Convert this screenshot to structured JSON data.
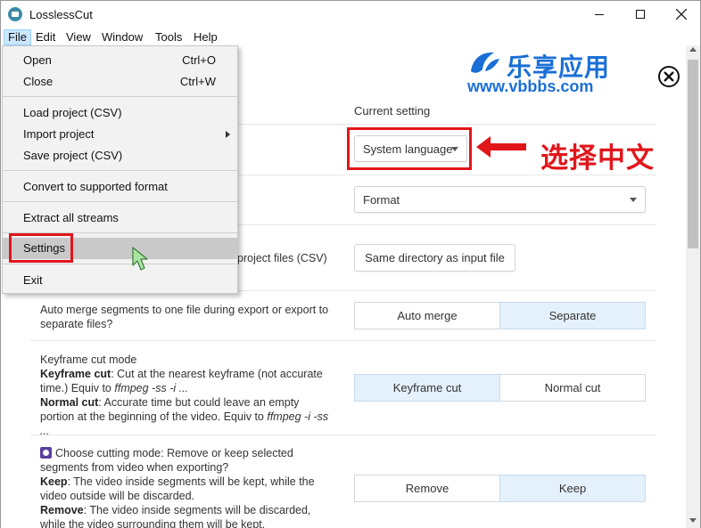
{
  "window": {
    "title": "LosslessCut"
  },
  "menubar": [
    "File",
    "Edit",
    "View",
    "Window",
    "Tools",
    "Help"
  ],
  "file_menu": {
    "open": "Open",
    "open_shortcut": "Ctrl+O",
    "close": "Close",
    "close_shortcut": "Ctrl+W",
    "load_project": "Load project (CSV)",
    "import_project": "Import project",
    "save_project": "Save project (CSV)",
    "convert": "Convert to supported format",
    "extract": "Extract all streams",
    "settings": "Settings",
    "exit": "Exit"
  },
  "watermark": {
    "cn": "乐享应用",
    "url": "www.vbbbs.com"
  },
  "annotation": "选择中文",
  "settings": {
    "current_setting_header": "Current setting",
    "language_value": "System language",
    "format_value": "Format",
    "project_files_tail": "project files (CSV)",
    "project_dir_button": "Same directory as input file",
    "auto_merge_label": "Auto merge segments to one file during export or export to separate files?",
    "auto_merge_btn": "Auto merge",
    "separate_btn": "Separate",
    "keyframe_title": "Keyframe cut mode",
    "keyframe_bold": "Keyframe cut",
    "keyframe_desc": ": Cut at the nearest keyframe (not accurate time.) Equiv to ",
    "keyframe_cmd": "ffmpeg -ss -i ...",
    "normal_bold": "Normal cut",
    "normal_desc": ": Accurate time but could leave an empty portion at the beginning of the video. Equiv to ",
    "normal_cmd": "ffmpeg -i -ss ...",
    "keyframe_btn": "Keyframe cut",
    "normal_btn": "Normal cut",
    "cutting_mode_label": "Choose cutting mode: Remove or keep selected segments from video when exporting?",
    "keep_bold": "Keep",
    "keep_desc": ": The video inside segments will be kept, while the video outside will be discarded.",
    "remove_bold": "Remove",
    "remove_desc": ": The video inside segments will be discarded, while the video surrounding them will be kept.",
    "remove_btn": "Remove",
    "keep_btn": "Keep"
  },
  "colors": {
    "accent_red": "#e0161b",
    "selected_segment": "#e4f0fb",
    "watermark_blue": "#1a6fd6"
  }
}
